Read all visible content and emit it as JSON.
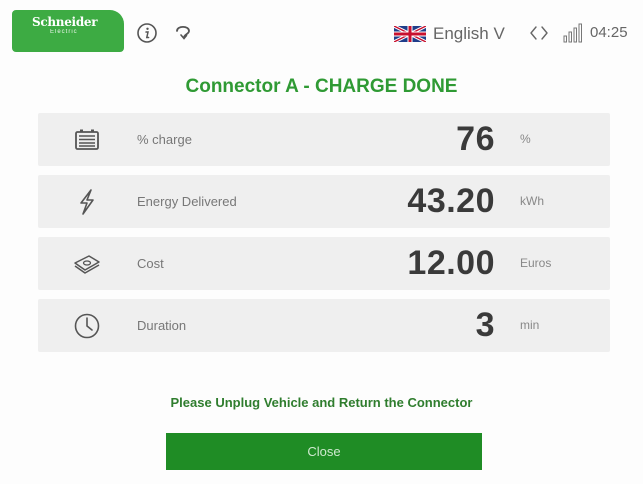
{
  "header": {
    "logo": {
      "name": "Schneider",
      "sub": "Electric"
    },
    "language": "English V",
    "time": "04:25",
    "icons": [
      "info-icon",
      "help-icon",
      "uk-flag-icon",
      "network-icon",
      "signal-icon"
    ]
  },
  "title": "Connector A - CHARGE DONE",
  "stats": [
    {
      "icon": "battery-icon",
      "label": "% charge",
      "value": "76",
      "unit": "%"
    },
    {
      "icon": "lightning-icon",
      "label": "Energy Delivered",
      "value": "43.20",
      "unit": "kWh"
    },
    {
      "icon": "money-icon",
      "label": "Cost",
      "value": "12.00",
      "unit": "Euros"
    },
    {
      "icon": "timer-icon",
      "label": "Duration",
      "value": "3",
      "unit": "min"
    }
  ],
  "instruction": "Please Unplug Vehicle and Return the Connector",
  "close_label": "Close",
  "colors": {
    "brand_green": "#3dab43",
    "title_green": "#2f9a34",
    "button_green": "#1f8c25",
    "row_bg": "#efefef"
  }
}
